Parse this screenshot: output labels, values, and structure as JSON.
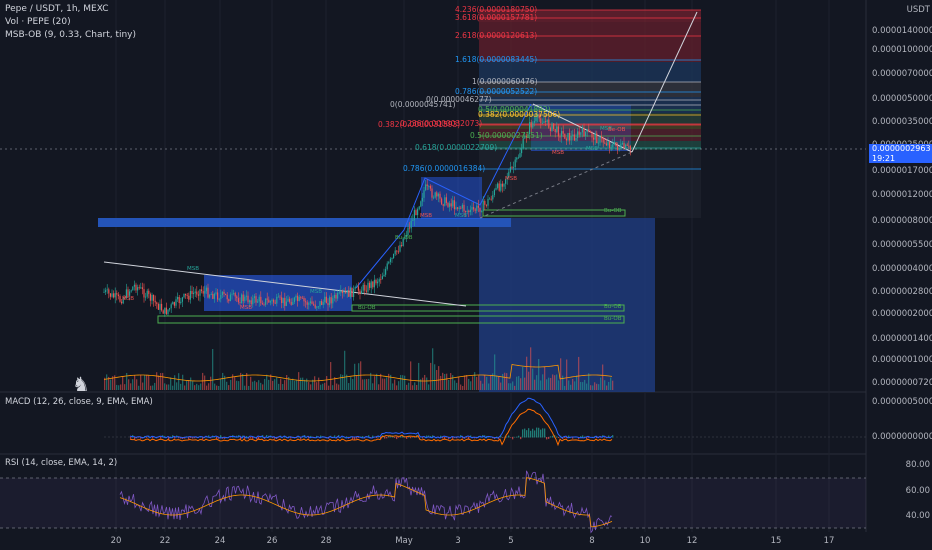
{
  "legend": {
    "title": "Pepe / USDT, 1h, MEXC",
    "vol": "Vol · PEPE (20)",
    "msb": "MSB-OB (9, 0.33, Chart, tiny)",
    "macd": "MACD (12, 26, close, 9, EMA, EMA)",
    "rsi": "RSI (14, close, EMA, 14, 2)"
  },
  "axis": {
    "currency": "USDT",
    "price_ticks": [
      "0.0000140000",
      "0.0000100000",
      "0.0000070000",
      "0.0000050000",
      "0.0000035000",
      "0.0000025000",
      "0.0000017000",
      "0.0000012000",
      "0.0000008000",
      "0.0000005500",
      "0.0000004000",
      "0.0000002800",
      "0.0000002000",
      "0.0000001400",
      "0.0000001000",
      "0.0000000720"
    ],
    "macd_ticks": [
      "0.0000005000",
      "0.0000000000"
    ],
    "rsi_ticks": [
      "80.00",
      "60.00",
      "40.00"
    ],
    "x_ticks": [
      "20",
      "22",
      "24",
      "26",
      "28",
      "May",
      "3",
      "5",
      "8",
      "10",
      "12",
      "15",
      "17"
    ]
  },
  "price_tag": {
    "price": "0.0000002963",
    "time": "19:21"
  },
  "fib_levels": [
    {
      "text": "4.236(0.0000180750)",
      "color": "#f23645"
    },
    {
      "text": "3.618(0.0000157781)",
      "color": "#f23645"
    },
    {
      "text": "2.618(0.0000120613)",
      "color": "#f23645"
    },
    {
      "text": "1.618(0.0000083445)",
      "color": "#2196f3"
    },
    {
      "text": "1(0.0000060476)",
      "color": "#b2b5be"
    },
    {
      "text": "0.786(0.0000052522)",
      "color": "#2196f3"
    },
    {
      "text": "0(0.0000046277)",
      "color": "#b2b5be"
    },
    {
      "text": "0(0.0000045741)",
      "color": "#b2b5be"
    },
    {
      "text": "0.5(0.0000041892)",
      "color": "#4caf50"
    },
    {
      "text": "0.382(0.0000037506)",
      "color": "#fbc02d"
    },
    {
      "text": "0.236(0.0000032073)",
      "color": "#f23645"
    },
    {
      "text": "0.382(0.0000031593)",
      "color": "#f23645"
    },
    {
      "text": "0.5(0.0000027151)",
      "color": "#4caf50"
    },
    {
      "text": "0.618(0.0000022709)",
      "color": "#26a69a"
    },
    {
      "text": "0.786(0.0000016384)",
      "color": "#2196f3"
    }
  ],
  "msb_tags": [
    "MSB",
    "MSB",
    "MSB",
    "MSB",
    "MSB",
    "MSB",
    "MSB",
    "MSB",
    "MSB",
    "MSB",
    "Bu-OB",
    "Bu-OB",
    "Bu-OB",
    "Bu-OB",
    "Bu-OB",
    "Be-OB"
  ],
  "chart_data": [
    {
      "type": "candlestick",
      "title": "Pepe / USDT, 1h, MEXC",
      "price_scale": "log",
      "x_dates": [
        "20",
        "22",
        "24",
        "26",
        "28",
        "May",
        "3",
        "5",
        "8"
      ],
      "approx_close": [
        4e-07,
        2.6e-07,
        2.8e-07,
        2.6e-07,
        3e-07,
        8e-07,
        1.1e-06,
        3.5e-06,
        2.963e-07
      ],
      "last_price": 2.963e-07
    },
    {
      "type": "bar",
      "name": "Vol · PEPE (20)"
    },
    {
      "type": "line",
      "name": "MACD (12, 26, close, 9, EMA, EMA)"
    },
    {
      "type": "line",
      "name": "RSI (14, close, EMA, 14, 2)",
      "ylim": [
        30,
        90
      ],
      "bands": [
        70,
        30
      ]
    }
  ]
}
